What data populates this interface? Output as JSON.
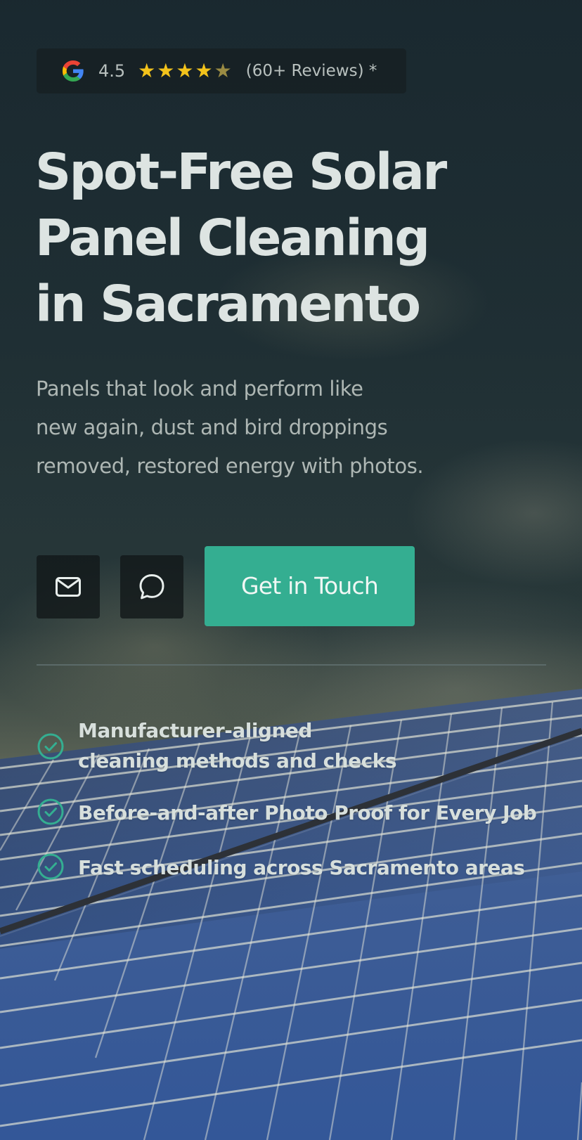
{
  "rating": {
    "score": "4.5",
    "reviews": "(60+ Reviews) *",
    "stars": "★★★★★",
    "star_level": 4.5,
    "google_icon": "google-g-icon"
  },
  "hero": {
    "title_lines": [
      "Spot-Free Solar",
      "Panel Cleaning",
      "in Sacramento"
    ],
    "copy_lines": [
      "Panels that look and perform like",
      "new again, dust and bird droppings",
      "removed, restored energy with photos."
    ]
  },
  "actions": {
    "email_icon": "mail-icon",
    "chat_icon": "chat-bubble-icon",
    "cta_label": "Get in Touch"
  },
  "features": [
    {
      "icon": "check-circle-icon",
      "lines": [
        "Manufacturer-aligned",
        "cleaning methods and checks"
      ]
    },
    {
      "icon": "check-circle-icon",
      "lines": [
        "Before-and-after Photo Proof for Every Job"
      ]
    },
    {
      "icon": "check-circle-icon",
      "lines": [
        "Fast scheduling across Sacramento areas"
      ]
    }
  ],
  "colors": {
    "accent": "#34ae91",
    "star": "#f3c31b",
    "title": "#dde4e2"
  }
}
